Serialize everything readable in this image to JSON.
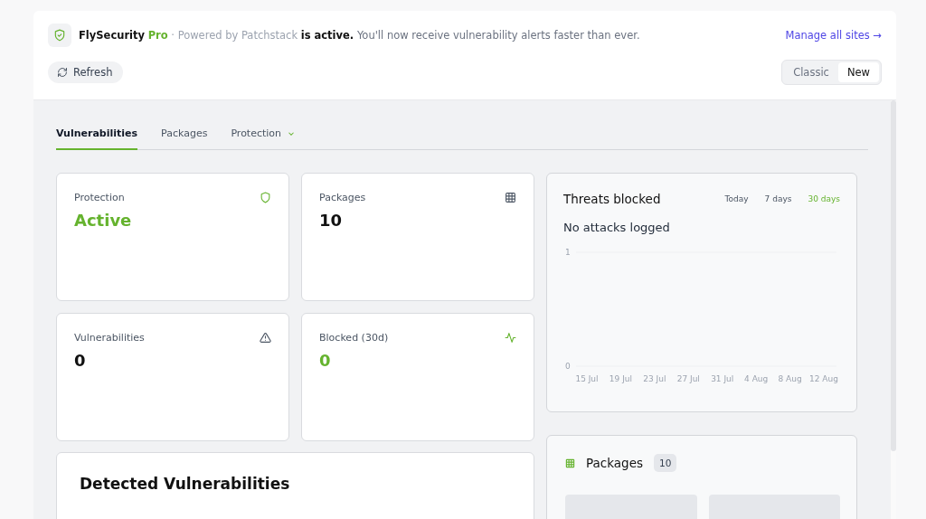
{
  "header": {
    "brand": "FlySecurity",
    "edition": "Pro",
    "powered_by": "· Powered by Patchstack",
    "status": "is active.",
    "message": "You'll now receive vulnerability alerts faster than ever.",
    "manage_link": "Manage all sites →",
    "refresh_button": "Refresh",
    "view_toggle": [
      {
        "label": "Classic",
        "selected": false
      },
      {
        "label": "New",
        "selected": true
      }
    ]
  },
  "tabs": [
    {
      "label": "Vulnerabilities",
      "selected": true,
      "dropdown": false
    },
    {
      "label": "Packages",
      "selected": false,
      "dropdown": false
    },
    {
      "label": "Protection",
      "selected": false,
      "dropdown": true
    }
  ],
  "stats": [
    {
      "label": "Protection",
      "value": "Active",
      "kind": "shield",
      "highlight": true
    },
    {
      "label": "Packages",
      "value": "10",
      "kind": "grid",
      "highlight": false
    },
    {
      "label": "Vulnerabilities",
      "value": "0",
      "kind": "warning",
      "highlight": false
    },
    {
      "label": "Blocked (30d)",
      "value": "0",
      "kind": "pulse",
      "highlight": true
    }
  ],
  "detected": {
    "title": "Detected Vulnerabilities"
  },
  "threats": {
    "title": "Threats blocked",
    "ranges": [
      {
        "label": "Today",
        "selected": false
      },
      {
        "label": "7 days",
        "selected": false
      },
      {
        "label": "30 days",
        "selected": true
      }
    ],
    "empty_message": "No attacks logged",
    "chart_data": {
      "type": "line",
      "categories": [
        "15 Jul",
        "19 Jul",
        "23 Jul",
        "27 Jul",
        "31 Jul",
        "4 Aug",
        "8 Aug",
        "12 Aug"
      ],
      "ylim": [
        0,
        1
      ],
      "yticks": [
        0,
        1
      ]
    }
  },
  "packages": {
    "title": "Packages",
    "count": "10",
    "tiles": [
      {
        "kind": "package"
      },
      {
        "kind": "package"
      }
    ]
  }
}
